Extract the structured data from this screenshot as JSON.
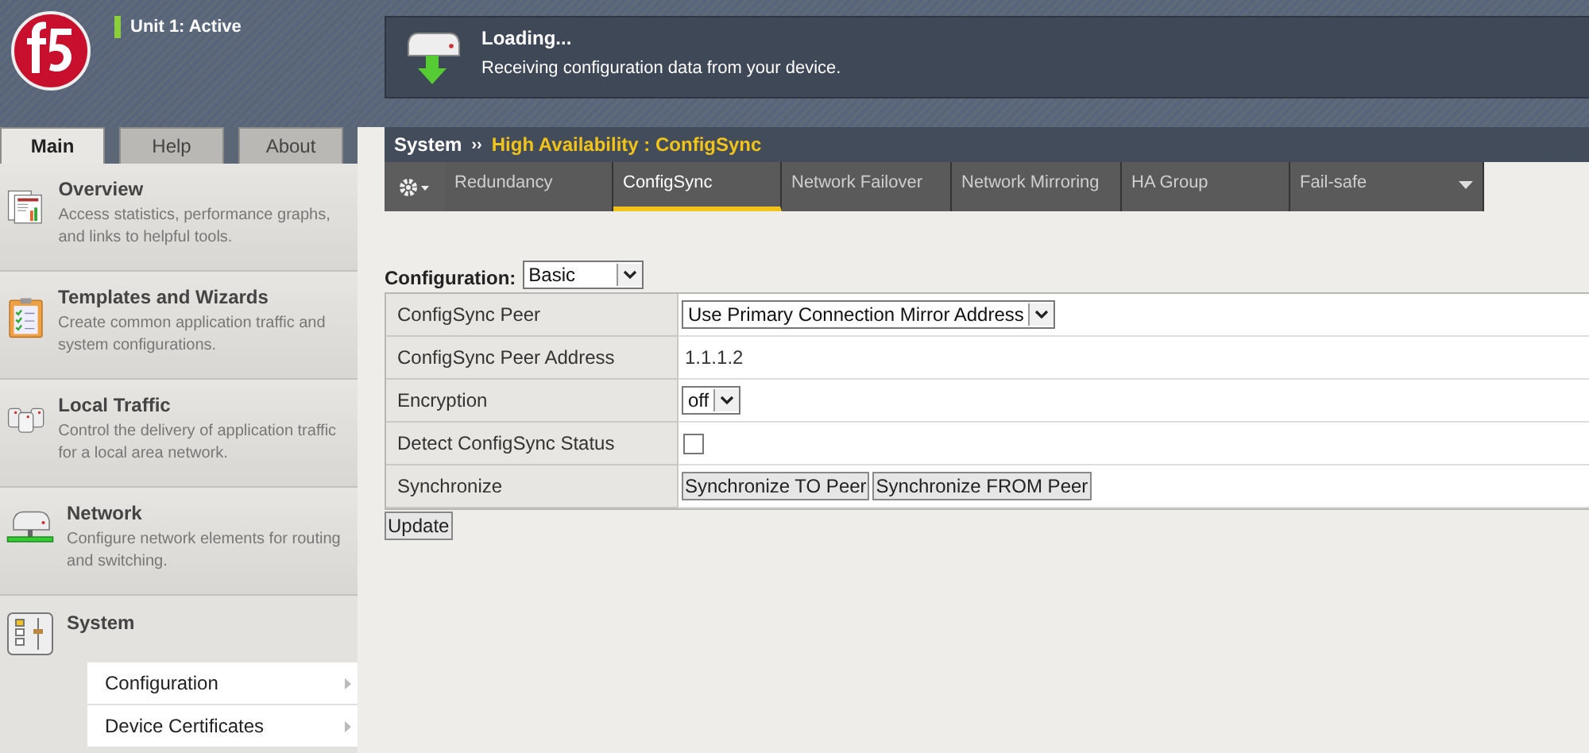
{
  "header": {
    "status": "Unit 1: Active"
  },
  "sidebar": {
    "tabs": [
      {
        "label": "Main",
        "selected": true
      },
      {
        "label": "Help",
        "selected": false
      },
      {
        "label": "About",
        "selected": false
      }
    ],
    "sections": [
      {
        "kind": "overview",
        "title": "Overview",
        "description": "Access statistics, performance graphs, and links to helpful tools."
      },
      {
        "kind": "templates",
        "title": "Templates and Wizards",
        "description": "Create common application traffic and system configurations."
      },
      {
        "kind": "traffic",
        "title": "Local Traffic",
        "description": "Control the delivery of application traffic for a local area network."
      },
      {
        "kind": "network",
        "title": "Network",
        "description": "Configure network elements for routing and switching."
      },
      {
        "kind": "system",
        "title": "System",
        "expanded": true,
        "items": [
          "Configuration",
          "Device Certificates"
        ]
      }
    ]
  },
  "banner": {
    "title": "Loading...",
    "message": "Receiving configuration data from your device."
  },
  "breadcrumb": {
    "root": "System",
    "separator": "››",
    "current": "High Availability : ConfigSync"
  },
  "tabs": [
    {
      "label": "Redundancy",
      "selected": false,
      "menu": false
    },
    {
      "label": "ConfigSync",
      "selected": true,
      "menu": false
    },
    {
      "label": "Network Failover",
      "selected": false,
      "menu": false
    },
    {
      "label": "Network Mirroring",
      "selected": false,
      "menu": false
    },
    {
      "label": "HA Group",
      "selected": false,
      "menu": false
    },
    {
      "label": "Fail-safe",
      "selected": false,
      "menu": true
    }
  ],
  "configuration": {
    "label": "Configuration:",
    "value": "Basic"
  },
  "form": [
    {
      "kind": "select",
      "label": "ConfigSync Peer",
      "value": "Use Primary Connection Mirror Address"
    },
    {
      "kind": "text",
      "label": "ConfigSync Peer Address",
      "value": "1.1.1.2"
    },
    {
      "kind": "select",
      "label": "Encryption",
      "value": "off"
    },
    {
      "kind": "checkbox",
      "label": "Detect ConfigSync Status",
      "checked": false
    },
    {
      "kind": "buttons",
      "label": "Synchronize",
      "buttons": [
        "Synchronize TO Peer",
        "Synchronize FROM Peer"
      ]
    }
  ],
  "update_button": "Update"
}
